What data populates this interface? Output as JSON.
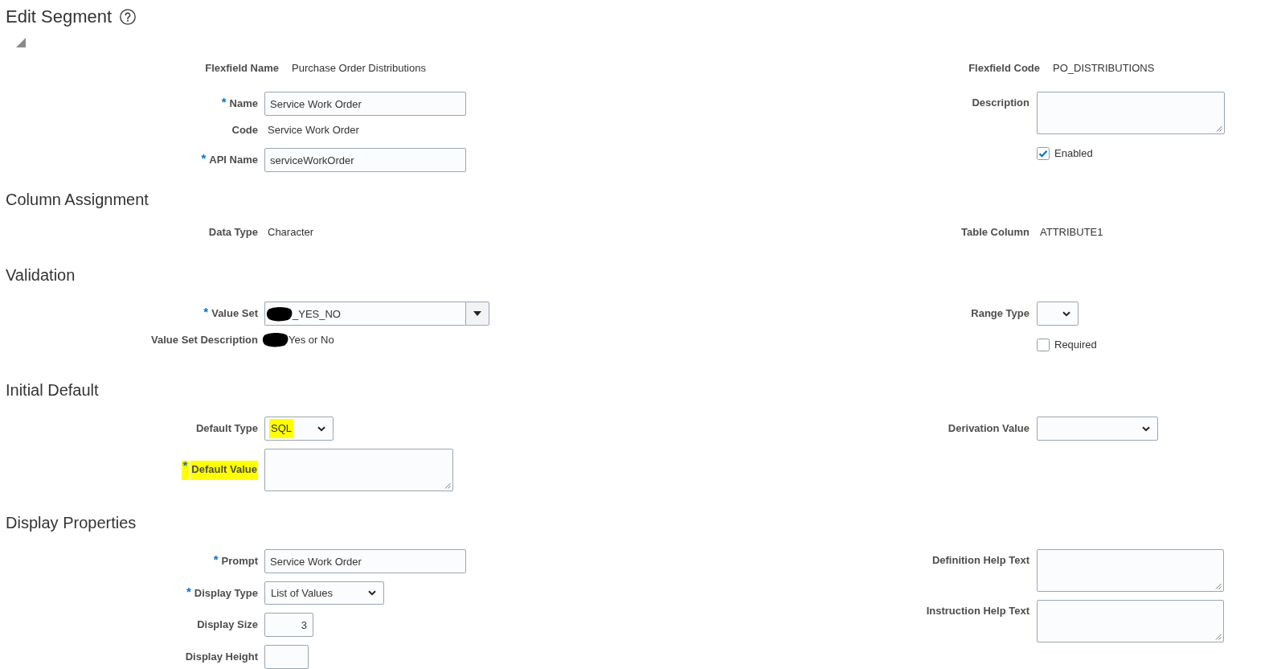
{
  "page": {
    "title": "Edit Segment"
  },
  "disclosure": {
    "expanded": true
  },
  "sections": [
    {
      "left": [
        {
          "kind": "meta",
          "label": "Flexfield Name",
          "value": "Purchase Order Distributions"
        },
        {
          "kind": "text",
          "mark": "*",
          "label": "Name",
          "value": "Service Work Order"
        },
        {
          "kind": "readonly",
          "label": "Code",
          "value": "Service Work Order"
        },
        {
          "kind": "text",
          "mark": "*",
          "label": "API Name",
          "value": "serviceWorkOrder"
        }
      ],
      "right": [
        {
          "kind": "meta",
          "label": "Flexfield Code",
          "value": "PO_DISTRIBUTIONS"
        },
        {
          "kind": "textarea",
          "label": "Description"
        },
        {
          "kind": "checkbox",
          "label": "Enabled",
          "checked": true
        }
      ]
    },
    {
      "heading": "Column Assignment",
      "left": [
        {
          "kind": "readonly",
          "label": "Data Type",
          "value": "Character"
        }
      ],
      "right": [
        {
          "kind": "readonly",
          "label": "Table Column",
          "value": "ATTRIBUTE1"
        }
      ]
    },
    {
      "heading": "Validation",
      "left": [
        {
          "kind": "lov",
          "mark": "*",
          "label": "Value Set",
          "value": "_YES_NO",
          "redacted": true
        },
        {
          "kind": "readonly",
          "label": "Value Set Description",
          "value": "Yes or No",
          "redacted": true
        }
      ],
      "right": [
        {
          "kind": "dropdown",
          "label": "Range Type"
        },
        {
          "kind": "checkbox",
          "label": "Required",
          "checked": false
        }
      ]
    },
    {
      "heading": "Initial Default",
      "left": [
        {
          "kind": "dropdown",
          "label": "Default Type",
          "value": "SQL",
          "value_highlighted": true
        },
        {
          "kind": "textarea",
          "mark": "*",
          "label": "Default Value",
          "label_highlighted": true
        }
      ],
      "right": [
        {
          "kind": "dropdown",
          "label": "Derivation Value"
        }
      ]
    },
    {
      "heading": "Display Properties",
      "left": [
        {
          "kind": "text",
          "mark": "*",
          "label": "Prompt",
          "value": "Service Work Order"
        },
        {
          "kind": "dropdown",
          "mark": "*",
          "label": "Display Type",
          "value": "List of Values"
        },
        {
          "kind": "number",
          "label": "Display Size",
          "value": "3"
        },
        {
          "kind": "number",
          "label": "Display Height"
        }
      ],
      "right": [
        {
          "kind": "textarea",
          "label": "Definition Help Text"
        },
        {
          "kind": "textarea",
          "label": "Instruction Help Text"
        }
      ]
    }
  ]
}
